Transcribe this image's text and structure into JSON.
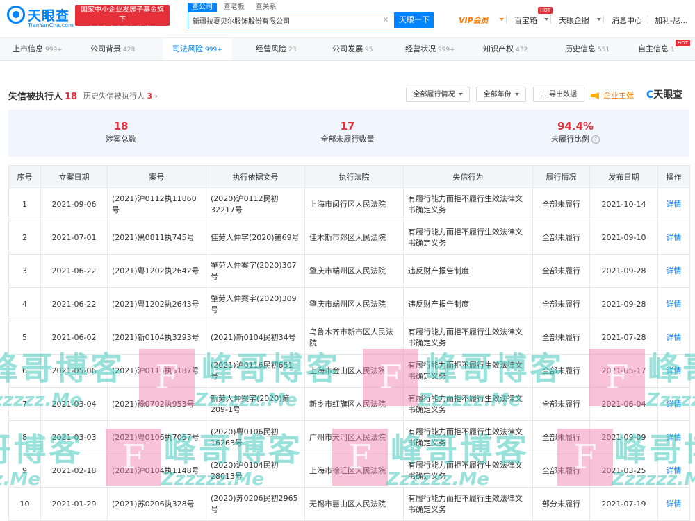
{
  "header": {
    "logo_text": "天眼查",
    "logo_sub": "TianYanCha.com",
    "slogan_line1": "国家中小企业发展子基金旗下",
    "slogan_line2": "官方备案企业征信机构",
    "search_tabs": [
      "查公司",
      "查老板",
      "查关系"
    ],
    "search_value": "新疆拉夏贝尔服饰股份有限公司",
    "search_button": "天眼一下",
    "vip": "VIP会员",
    "baibaoxiang": "百宝箱",
    "hot": "HOT",
    "tianyan_qiban": "天眼企服",
    "message_center": "消息中心",
    "user": "加利-尼..."
  },
  "tabs": [
    {
      "label": "上市信息",
      "count": "999+"
    },
    {
      "label": "公司背景",
      "count": "428"
    },
    {
      "label": "司法风险",
      "count": "999+"
    },
    {
      "label": "经营风险",
      "count": "23"
    },
    {
      "label": "公司发展",
      "count": "95"
    },
    {
      "label": "经营状况",
      "count": "999+"
    },
    {
      "label": "知识产权",
      "count": "432"
    },
    {
      "label": "历史信息",
      "count": "551"
    },
    {
      "label": "自主信息",
      "count": "1"
    }
  ],
  "section": {
    "title": "失信被执行人",
    "count": "18",
    "history_label": "历史失信被执行人",
    "history_count": "3",
    "filter_status": "全部履行情况",
    "filter_year": "全部年份",
    "export": "导出数据",
    "enterprise_speak": "企业主张",
    "brand": "天眼查"
  },
  "stats": [
    {
      "num": "18",
      "label": "涉案总数"
    },
    {
      "num": "17",
      "label": "全部未履行数量"
    },
    {
      "num": "94.4%",
      "label": "未履行比例"
    }
  ],
  "table": {
    "headers": [
      "序号",
      "立案日期",
      "案号",
      "执行依据文号",
      "执行法院",
      "失信行为",
      "履行情况",
      "发布日期",
      "操作"
    ],
    "rows": [
      {
        "no": "1",
        "date": "2021-09-06",
        "case": "(2021)沪0112执11860号",
        "basis": "(2020)沪0112民初32217号",
        "court": "上海市闵行区人民法院",
        "behavior": "有履行能力而拒不履行生效法律文书确定义务",
        "status": "全部未履行",
        "pub": "2021-10-14",
        "op": "详情"
      },
      {
        "no": "2",
        "date": "2021-07-01",
        "case": "(2021)黑0811执745号",
        "basis": "佳劳人仲字(2020)第69号",
        "court": "佳木斯市郊区人民法院",
        "behavior": "有履行能力而拒不履行生效法律文书确定义务",
        "status": "全部未履行",
        "pub": "2021-09-10",
        "op": "详情"
      },
      {
        "no": "3",
        "date": "2021-06-22",
        "case": "(2021)粤1202执2642号",
        "basis": "肇劳人仲案字(2020)307号",
        "court": "肇庆市端州区人民法院",
        "behavior": "违反财产报告制度",
        "status": "全部未履行",
        "pub": "2021-09-28",
        "op": "详情"
      },
      {
        "no": "4",
        "date": "2021-06-22",
        "case": "(2021)粤1202执2643号",
        "basis": "肇劳人仲案字(2020)309号",
        "court": "肇庆市端州区人民法院",
        "behavior": "违反财产报告制度",
        "status": "全部未履行",
        "pub": "2021-09-28",
        "op": "详情"
      },
      {
        "no": "5",
        "date": "2021-06-02",
        "case": "(2021)新0104执3293号",
        "basis": "(2021)新0104民初34号",
        "court": "乌鲁木齐市新市区人民法院",
        "behavior": "有履行能力而拒不履行生效法律文书确定义务",
        "status": "全部未履行",
        "pub": "2021-07-28",
        "op": "详情"
      },
      {
        "no": "6",
        "date": "2021-05-06",
        "case": "(2021)沪0116执3187号",
        "basis": "(2021)沪0116民初651号",
        "court": "上海市金山区人民法院",
        "behavior": "有履行能力而拒不履行生效法律文书确定义务",
        "status": "全部未履行",
        "pub": "2021-05-17",
        "op": "详情"
      },
      {
        "no": "7",
        "date": "2021-03-04",
        "case": "(2021)豫0702执953号",
        "basis": "新劳人仲案字(2020)第209-1号",
        "court": "新乡市红旗区人民法院",
        "behavior": "有履行能力而拒不履行生效法律文书确定义务",
        "status": "全部未履行",
        "pub": "2021-06-04",
        "op": "详情"
      },
      {
        "no": "8",
        "date": "2021-03-03",
        "case": "(2021)粤0106执7067号",
        "basis": "(2020)粤0106民初16263号",
        "court": "广州市天河区人民法院",
        "behavior": "有履行能力而拒不履行生效法律文书确定义务",
        "status": "全部未履行",
        "pub": "2021-09-09",
        "op": "详情"
      },
      {
        "no": "9",
        "date": "2021-02-18",
        "case": "(2021)沪0104执1148号",
        "basis": "(2020)沪0104民初28013号",
        "court": "上海市徐汇区人民法院",
        "behavior": "有履行能力而拒不履行生效法律文书确定义务",
        "status": "全部未履行",
        "pub": "2021-03-25",
        "op": "详情"
      },
      {
        "no": "10",
        "date": "2021-01-29",
        "case": "(2021)苏0206执328号",
        "basis": "(2020)苏0206民初2965号",
        "court": "无锡市惠山区人民法院",
        "behavior": "有履行能力而拒不履行生效法律文书确定义务",
        "status": "部分未履行",
        "pub": "2021-07-19",
        "op": "详情"
      }
    ]
  },
  "watermark": {
    "text": "峰哥博客",
    "sub": "Zzzzzz.Me",
    "f": "F"
  },
  "colors": {
    "accent": "#0084ff",
    "danger": "#e5303a",
    "vip": "#ff7a00"
  }
}
